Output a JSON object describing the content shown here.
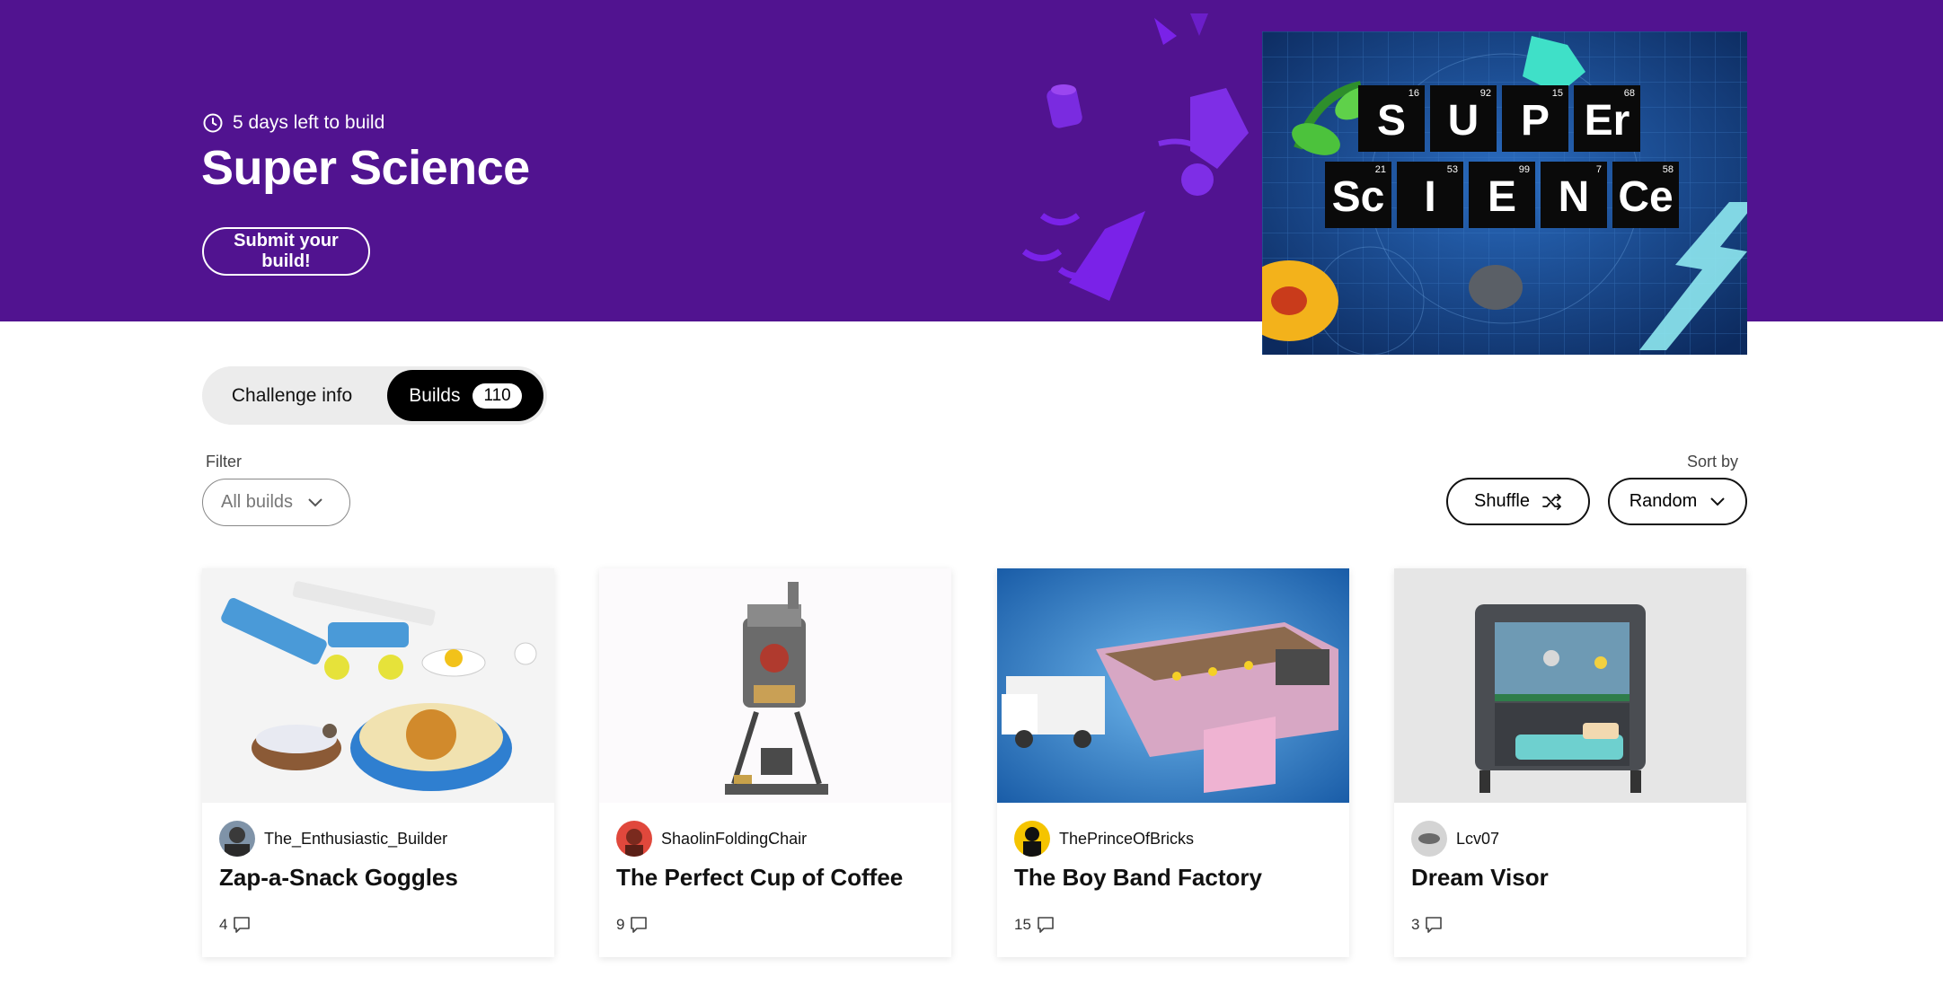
{
  "hero": {
    "countdown": "5 days left to build",
    "title": "Super Science",
    "submit_label": "Submit your build!",
    "image_text": {
      "row1": [
        {
          "symbol": "S",
          "number": "16"
        },
        {
          "symbol": "U",
          "number": "92"
        },
        {
          "symbol": "P",
          "number": "15"
        },
        {
          "symbol": "Er",
          "number": "68"
        }
      ],
      "row2": [
        {
          "symbol": "Sc",
          "number": "21"
        },
        {
          "symbol": "I",
          "number": "53"
        },
        {
          "symbol": "E",
          "number": "99"
        },
        {
          "symbol": "N",
          "number": "7"
        },
        {
          "symbol": "Ce",
          "number": "58"
        }
      ]
    }
  },
  "tabs": {
    "info_label": "Challenge info",
    "builds_label": "Builds",
    "builds_count": "110"
  },
  "filter": {
    "label": "Filter",
    "value": "All builds"
  },
  "sort": {
    "label": "Sort by",
    "shuffle_label": "Shuffle",
    "value": "Random"
  },
  "cards": [
    {
      "author": "The_Enthusiastic_Builder",
      "title": "Zap-a-Snack Goggles",
      "comments": "4"
    },
    {
      "author": "ShaolinFoldingChair",
      "title": "The Perfect Cup of Coffee",
      "comments": "9"
    },
    {
      "author": "ThePrinceOfBricks",
      "title": "The Boy Band Factory",
      "comments": "15"
    },
    {
      "author": "Lcv07",
      "title": "Dream Visor",
      "comments": "3"
    }
  ],
  "colors": {
    "hero_bg": "#511390",
    "accent_purple": "#8a2be2",
    "active_tab_bg": "#000000"
  },
  "icons": [
    "clock-icon",
    "chevron-down-icon",
    "shuffle-icon",
    "comment-icon"
  ]
}
